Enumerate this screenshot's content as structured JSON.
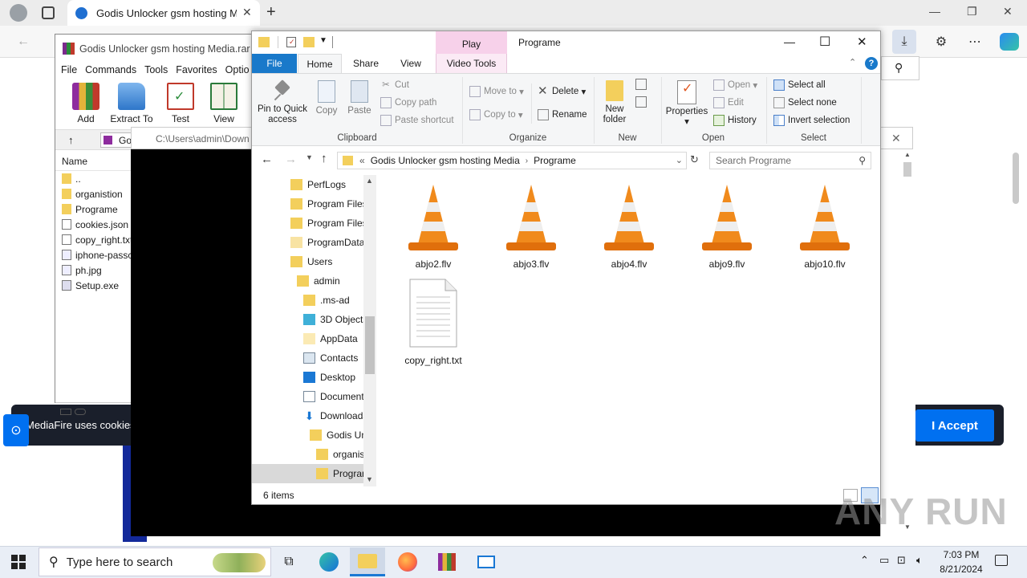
{
  "browser": {
    "tab_title": "Godis Unlocker gsm hosting Me",
    "new_tab": "+",
    "window_controls": {
      "minimize": "—",
      "maximize": "❐",
      "close": "✕"
    }
  },
  "winrar": {
    "title": "Godis Unlocker gsm hosting Media.rar",
    "menu": [
      "File",
      "Commands",
      "Tools",
      "Favorites",
      "Optio"
    ],
    "tools": [
      "Add",
      "Extract To",
      "Test",
      "View"
    ],
    "address_fragment": "Go",
    "column_name": "Name",
    "files": [
      "..",
      "organistion",
      "Programe",
      "cookies.json",
      "copy_right.txt",
      "iphone-passc",
      "ph.jpg",
      "Setup.exe"
    ]
  },
  "video_player": {
    "path": "C:\\Users\\admin\\Down",
    "close": "✕"
  },
  "cookie": {
    "text": "MediaFire uses cookies",
    "accept": "I Accept"
  },
  "explorer": {
    "title": "Programe",
    "play_tab": "Play",
    "tabs": [
      "File",
      "Home",
      "Share",
      "View",
      "Video Tools"
    ],
    "window_controls": {
      "minimize": "—",
      "maximize": "☐",
      "close": "✕"
    },
    "help": "?",
    "ribbon": {
      "clipboard": {
        "label": "Clipboard",
        "pin": "Pin to Quick access",
        "copy": "Copy",
        "paste": "Paste",
        "cut": "Cut",
        "copy_path": "Copy path",
        "paste_shortcut": "Paste shortcut"
      },
      "organize": {
        "label": "Organize",
        "move_to": "Move to",
        "copy_to": "Copy to",
        "delete": "Delete",
        "rename": "Rename"
      },
      "new": {
        "label": "New",
        "new_folder": "New folder"
      },
      "open": {
        "label": "Open",
        "properties": "Properties",
        "open": "Open",
        "edit": "Edit",
        "history": "History"
      },
      "select": {
        "label": "Select",
        "select_all": "Select all",
        "select_none": "Select none",
        "invert": "Invert selection"
      }
    },
    "address": {
      "prefix": "«",
      "crumbs": [
        "Godis Unlocker gsm hosting Media",
        "Programe"
      ]
    },
    "search_placeholder": "Search Programe",
    "nav_items": [
      "PerfLogs",
      "Program Files",
      "Program Files",
      "ProgramData",
      "Users",
      "admin",
      ".ms-ad",
      "3D Objects",
      "AppData",
      "Contacts",
      "Desktop",
      "Documents",
      "Downloads",
      "Godis Un",
      "organis",
      "Program"
    ],
    "files": [
      "abjo2.flv",
      "abjo3.flv",
      "abjo4.flv",
      "abjo9.flv",
      "abjo10.flv",
      "copy_right.txt"
    ],
    "status": "6 items"
  },
  "taskbar": {
    "search_placeholder": "Type here to search",
    "time": "7:03 PM",
    "date": "8/21/2024"
  },
  "watermark": "ANY RUN",
  "colors": {
    "accent": "#0070f0",
    "file_tab": "#1979ca",
    "play_tab": "#f7d1ea",
    "cone_orange": "#f08a1c"
  }
}
